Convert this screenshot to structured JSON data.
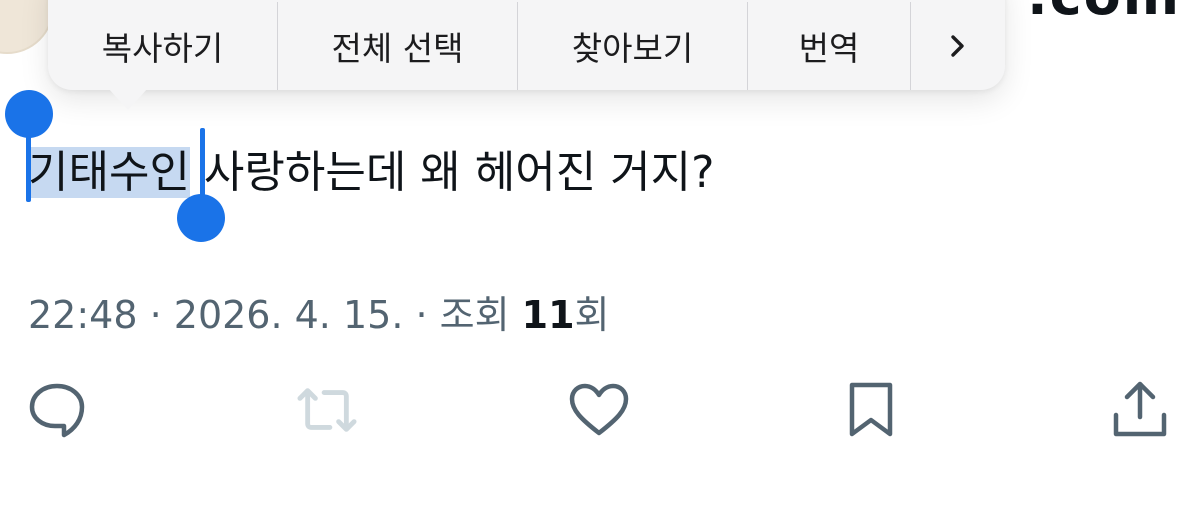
{
  "header": {
    "handle_fragment": ".com"
  },
  "context_menu": {
    "items": [
      {
        "label": "복사하기"
      },
      {
        "label": "전체 선택"
      },
      {
        "label": "찾아보기"
      },
      {
        "label": "번역"
      }
    ],
    "more_icon": "chevron-right-icon"
  },
  "tweet": {
    "selected_text": "기태수인",
    "rest_text": " 사랑하는데 왜 헤어진 거지?"
  },
  "meta": {
    "time": "22:48",
    "sep1": " · ",
    "date": "2026. 4. 15.",
    "sep2": " · ",
    "views_label": "조회 ",
    "views_count": "11",
    "views_suffix": "회"
  },
  "actions": {
    "icons": [
      "reply-icon",
      "retweet-icon",
      "like-icon",
      "bookmark-icon",
      "share-icon"
    ],
    "icon_color": "#536471",
    "disabled_color": "#cfd9de"
  },
  "colors": {
    "selection_handle": "#1a73e8",
    "selection_bg": "#c6d9f1"
  }
}
